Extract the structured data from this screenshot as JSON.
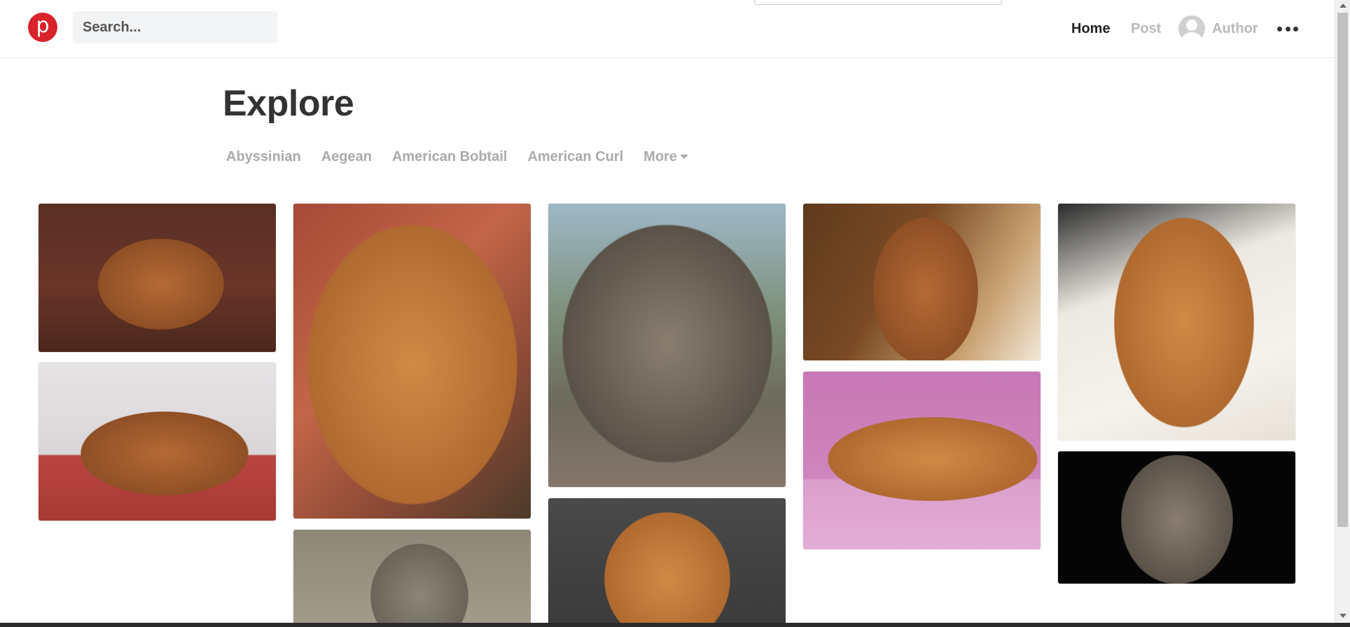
{
  "header": {
    "logo_letter": "p",
    "search_placeholder": "Search...",
    "nav": {
      "home": "Home",
      "post": "Post",
      "author": "Author"
    }
  },
  "page": {
    "title": "Explore"
  },
  "categories": [
    "Abyssinian",
    "Aegean",
    "American Bobtail",
    "American Curl"
  ],
  "more_label": "More",
  "colors": {
    "brand": "#d8232a",
    "nav_active": "#222222",
    "nav_inactive": "#b9b9b9",
    "category_text": "#aaaaaa"
  },
  "icons": {
    "logo": "pinterest-p-logo",
    "avatar": "user-avatar-icon",
    "menu": "more-dots-icon",
    "dropdown": "caret-down-icon"
  },
  "gallery": [
    {
      "subject": "cat"
    },
    {
      "subject": "cat"
    },
    {
      "subject": "cat"
    },
    {
      "subject": "cat"
    },
    {
      "subject": "cat"
    },
    {
      "subject": "cat"
    },
    {
      "subject": "cat"
    },
    {
      "subject": "cat"
    },
    {
      "subject": "cat"
    },
    {
      "subject": "cat"
    }
  ]
}
